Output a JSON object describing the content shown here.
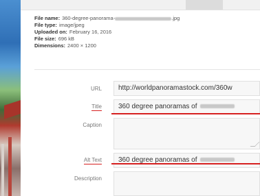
{
  "file_info": {
    "name_label": "File name:",
    "name_value": "360-degree-panorama-",
    "name_ext": ".jpg",
    "type_label": "File type:",
    "type_value": "image/jpeg",
    "uploaded_label": "Uploaded on:",
    "uploaded_value": "February 16, 2016",
    "size_label": "File size:",
    "size_value": "696 kB",
    "dimensions_label": "Dimensions:",
    "dimensions_value": "2400 × 1200"
  },
  "fields": {
    "url_label": "URL",
    "url_value": "http://worldpanoramastock.com/360w",
    "title_label": "Title",
    "title_value": "360 degree panoramas of",
    "caption_label": "Caption",
    "caption_value": "",
    "alt_label": "Alt Text",
    "alt_value": "360 degree panoramas of",
    "description_label": "Description",
    "description_value": ""
  },
  "colors": {
    "highlight": "#d61f1f"
  }
}
